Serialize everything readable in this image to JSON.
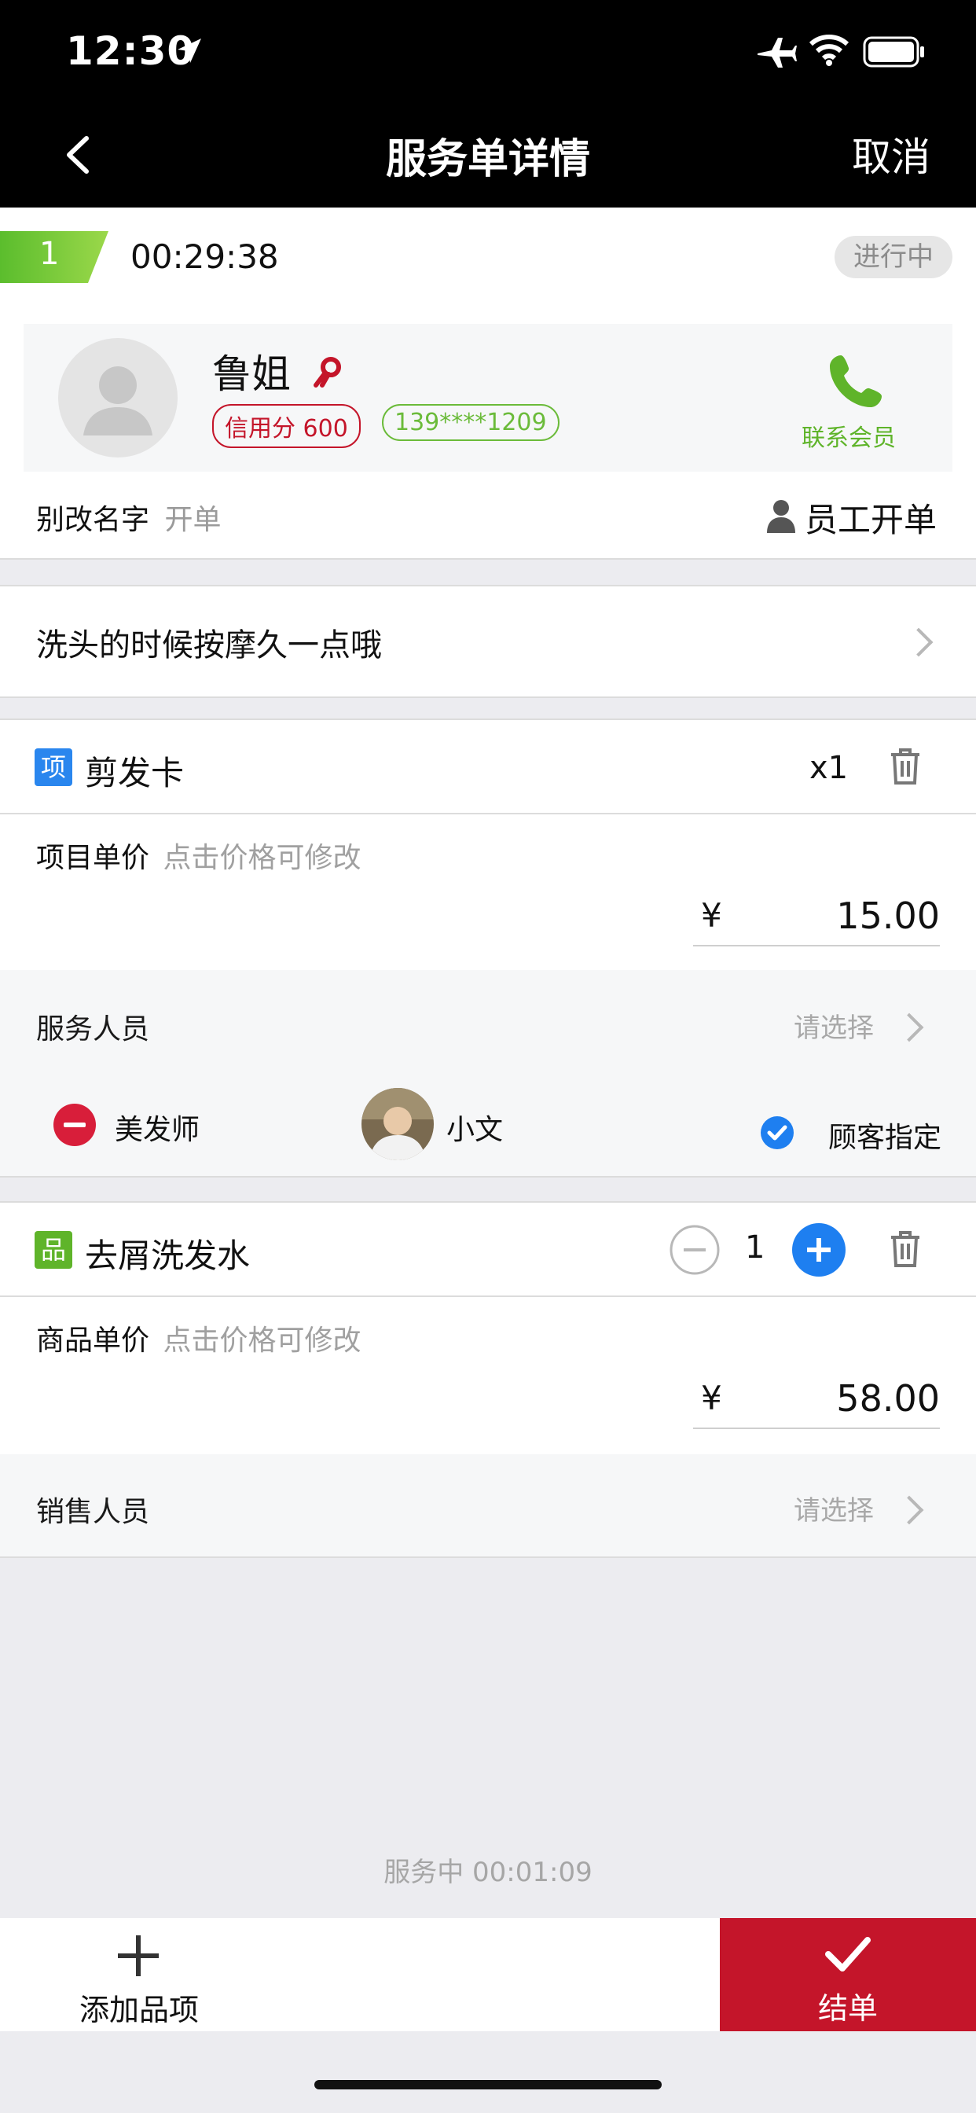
{
  "status_bar": {
    "time": "12:30"
  },
  "nav": {
    "title": "服务单详情",
    "cancel": "取消"
  },
  "order": {
    "number": "1",
    "timer": "00:29:38",
    "status": "进行中"
  },
  "member": {
    "name": "鲁姐",
    "credit": "信用分 600",
    "phone": "139****1209",
    "contact_label": "联系会员"
  },
  "opener": {
    "name": "别改名字",
    "suffix": "开单",
    "type": "员工开单"
  },
  "note": "洗头的时候按摩久一点哦",
  "items": [
    {
      "badge": "项",
      "name": "剪发卡",
      "qty": "x1",
      "price_label": "项目单价",
      "price_hint": "点击价格可修改",
      "currency": "¥",
      "price": "15.00",
      "staff_label": "服务人员",
      "staff_select": "请选择",
      "staff": {
        "role": "美发师",
        "name": "小文",
        "designated": "顾客指定"
      }
    },
    {
      "badge": "品",
      "name": "去屑洗发水",
      "qty": "1",
      "price_label": "商品单价",
      "price_hint": "点击价格可修改",
      "currency": "¥",
      "price": "58.00",
      "staff_label": "销售人员",
      "staff_select": "请选择"
    }
  ],
  "service_status": "服务中 00:01:09",
  "bottom": {
    "add_label": "添加品项",
    "checkout_label": "结单"
  },
  "colors": {
    "accent_red": "#c4152a",
    "green": "#6bbb3a",
    "blue": "#1e7ff0"
  }
}
